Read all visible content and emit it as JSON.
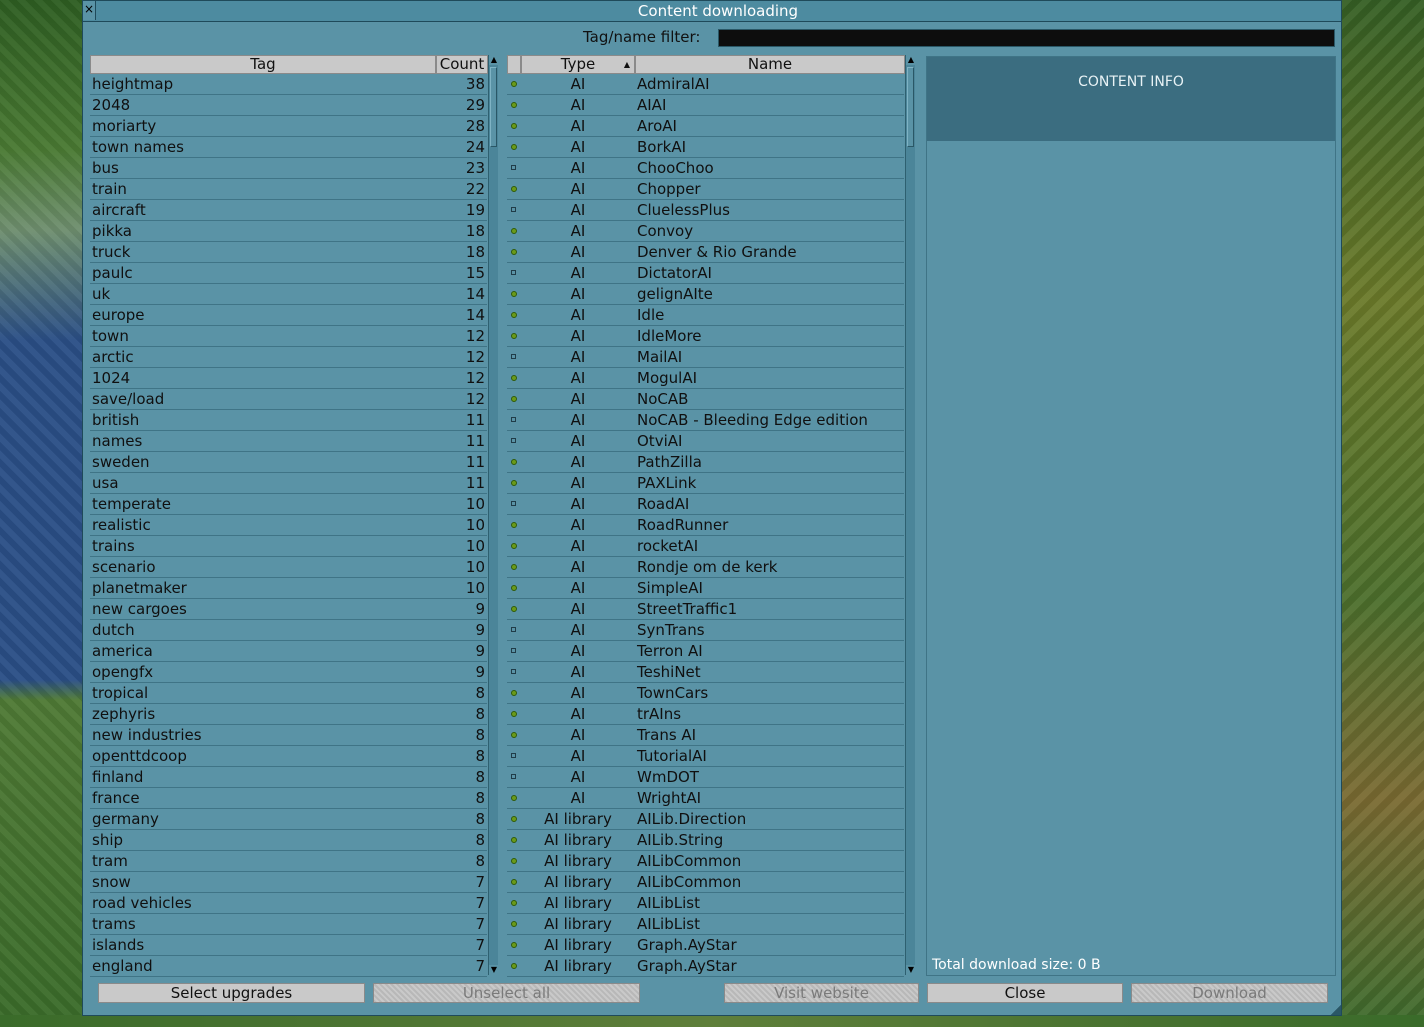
{
  "window": {
    "title": "Content downloading",
    "close_glyph": "×"
  },
  "filter": {
    "label": "Tag/name filter:",
    "value": ""
  },
  "tag_list": {
    "headers": {
      "tag": "Tag",
      "count": "Count"
    },
    "rows": [
      {
        "tag": "heightmap",
        "count": "38"
      },
      {
        "tag": "2048",
        "count": "29"
      },
      {
        "tag": "moriarty",
        "count": "28"
      },
      {
        "tag": "town names",
        "count": "24"
      },
      {
        "tag": "bus",
        "count": "23"
      },
      {
        "tag": "train",
        "count": "22"
      },
      {
        "tag": "aircraft",
        "count": "19"
      },
      {
        "tag": "pikka",
        "count": "18"
      },
      {
        "tag": "truck",
        "count": "18"
      },
      {
        "tag": "paulc",
        "count": "15"
      },
      {
        "tag": "uk",
        "count": "14"
      },
      {
        "tag": "europe",
        "count": "14"
      },
      {
        "tag": "town",
        "count": "12"
      },
      {
        "tag": "arctic",
        "count": "12"
      },
      {
        "tag": "1024",
        "count": "12"
      },
      {
        "tag": "save/load",
        "count": "12"
      },
      {
        "tag": "british",
        "count": "11"
      },
      {
        "tag": "names",
        "count": "11"
      },
      {
        "tag": "sweden",
        "count": "11"
      },
      {
        "tag": "usa",
        "count": "11"
      },
      {
        "tag": "temperate",
        "count": "10"
      },
      {
        "tag": "realistic",
        "count": "10"
      },
      {
        "tag": "trains",
        "count": "10"
      },
      {
        "tag": "scenario",
        "count": "10"
      },
      {
        "tag": "planetmaker",
        "count": "10"
      },
      {
        "tag": "new cargoes",
        "count": "9"
      },
      {
        "tag": "dutch",
        "count": "9"
      },
      {
        "tag": "america",
        "count": "9"
      },
      {
        "tag": "opengfx",
        "count": "9"
      },
      {
        "tag": "tropical",
        "count": "8"
      },
      {
        "tag": "zephyris",
        "count": "8"
      },
      {
        "tag": "new industries",
        "count": "8"
      },
      {
        "tag": "openttdcoop",
        "count": "8"
      },
      {
        "tag": "finland",
        "count": "8"
      },
      {
        "tag": "france",
        "count": "8"
      },
      {
        "tag": "germany",
        "count": "8"
      },
      {
        "tag": "ship",
        "count": "8"
      },
      {
        "tag": "tram",
        "count": "8"
      },
      {
        "tag": "snow",
        "count": "7"
      },
      {
        "tag": "road vehicles",
        "count": "7"
      },
      {
        "tag": "trams",
        "count": "7"
      },
      {
        "tag": "islands",
        "count": "7"
      },
      {
        "tag": "england",
        "count": "7"
      }
    ]
  },
  "content_list": {
    "headers": {
      "type": "Type",
      "name": "Name",
      "sort_glyph": "▲"
    },
    "rows": [
      {
        "status": "available",
        "type": "AI",
        "name": "AdmiralAI"
      },
      {
        "status": "available",
        "type": "AI",
        "name": "AIAI"
      },
      {
        "status": "available",
        "type": "AI",
        "name": "AroAI"
      },
      {
        "status": "available",
        "type": "AI",
        "name": "BorkAI"
      },
      {
        "status": "unavailable",
        "type": "AI",
        "name": "ChooChoo"
      },
      {
        "status": "available",
        "type": "AI",
        "name": "Chopper"
      },
      {
        "status": "unavailable",
        "type": "AI",
        "name": "CluelessPlus"
      },
      {
        "status": "available",
        "type": "AI",
        "name": "Convoy"
      },
      {
        "status": "available",
        "type": "AI",
        "name": "Denver & Rio Grande"
      },
      {
        "status": "unavailable",
        "type": "AI",
        "name": "DictatorAI"
      },
      {
        "status": "available",
        "type": "AI",
        "name": "gelignAIte"
      },
      {
        "status": "available",
        "type": "AI",
        "name": "Idle"
      },
      {
        "status": "available",
        "type": "AI",
        "name": "IdleMore"
      },
      {
        "status": "unavailable",
        "type": "AI",
        "name": "MailAI"
      },
      {
        "status": "available",
        "type": "AI",
        "name": "MogulAI"
      },
      {
        "status": "available",
        "type": "AI",
        "name": "NoCAB"
      },
      {
        "status": "unavailable",
        "type": "AI",
        "name": "NoCAB - Bleeding Edge edition"
      },
      {
        "status": "unavailable",
        "type": "AI",
        "name": "OtviAI"
      },
      {
        "status": "available",
        "type": "AI",
        "name": "PathZilla"
      },
      {
        "status": "available",
        "type": "AI",
        "name": "PAXLink"
      },
      {
        "status": "unavailable",
        "type": "AI",
        "name": "RoadAI"
      },
      {
        "status": "available",
        "type": "AI",
        "name": "RoadRunner"
      },
      {
        "status": "available",
        "type": "AI",
        "name": "rocketAI"
      },
      {
        "status": "available",
        "type": "AI",
        "name": "Rondje om de kerk"
      },
      {
        "status": "available",
        "type": "AI",
        "name": "SimpleAI"
      },
      {
        "status": "available",
        "type": "AI",
        "name": "StreetTraffic1"
      },
      {
        "status": "unavailable",
        "type": "AI",
        "name": "SynTrans"
      },
      {
        "status": "unavailable",
        "type": "AI",
        "name": "Terron AI"
      },
      {
        "status": "unavailable",
        "type": "AI",
        "name": "TeshiNet"
      },
      {
        "status": "available",
        "type": "AI",
        "name": "TownCars"
      },
      {
        "status": "available",
        "type": "AI",
        "name": "trAIns"
      },
      {
        "status": "available",
        "type": "AI",
        "name": "Trans AI"
      },
      {
        "status": "unavailable",
        "type": "AI",
        "name": "TutorialAI"
      },
      {
        "status": "unavailable",
        "type": "AI",
        "name": "WmDOT"
      },
      {
        "status": "available",
        "type": "AI",
        "name": "WrightAI"
      },
      {
        "status": "available",
        "type": "AI library",
        "name": "AILib.Direction"
      },
      {
        "status": "available",
        "type": "AI library",
        "name": "AILib.String"
      },
      {
        "status": "available",
        "type": "AI library",
        "name": "AILibCommon"
      },
      {
        "status": "available",
        "type": "AI library",
        "name": "AILibCommon"
      },
      {
        "status": "available",
        "type": "AI library",
        "name": "AILibList"
      },
      {
        "status": "available",
        "type": "AI library",
        "name": "AILibList"
      },
      {
        "status": "available",
        "type": "AI library",
        "name": "Graph.AyStar"
      },
      {
        "status": "available",
        "type": "AI library",
        "name": "Graph.AyStar"
      }
    ]
  },
  "info": {
    "heading": "CONTENT INFO",
    "total_size": "Total download size: 0 B"
  },
  "buttons": {
    "select_upgrades": "Select upgrades",
    "unselect_all": "Unselect all",
    "visit_website": "Visit website",
    "close": "Close",
    "download": "Download"
  },
  "colors": {
    "window_bg": "#5a93a6",
    "info_header_bg": "#3b6d80",
    "status_available": "#6a9a1a"
  }
}
